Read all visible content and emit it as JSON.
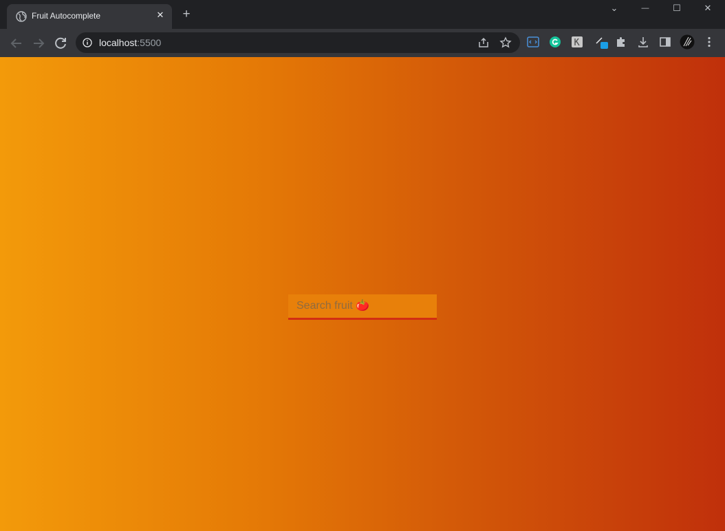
{
  "browser": {
    "tab": {
      "title": "Fruit Autocomplete",
      "icon": "globe-icon",
      "close_label": "✕"
    },
    "new_tab_label": "+",
    "window_controls": {
      "chevron": "⌄",
      "minimize": "—",
      "maximize": "☐",
      "close": "✕"
    },
    "toolbar": {
      "url_host": "localhost",
      "url_port": ":5500",
      "extensions": [
        "code-extension-icon",
        "grammarly-icon",
        "extension-k-icon",
        "pen-extension-icon",
        "puzzle-icon",
        "download-icon",
        "side-panel-icon",
        "profile-avatar",
        "menu-icon"
      ]
    }
  },
  "page": {
    "search": {
      "placeholder": "Search fruit 🍅",
      "value": ""
    },
    "colors": {
      "gradient_start": "#f39a0a",
      "gradient_end": "#c0300b",
      "underline": "#d22e12"
    }
  }
}
